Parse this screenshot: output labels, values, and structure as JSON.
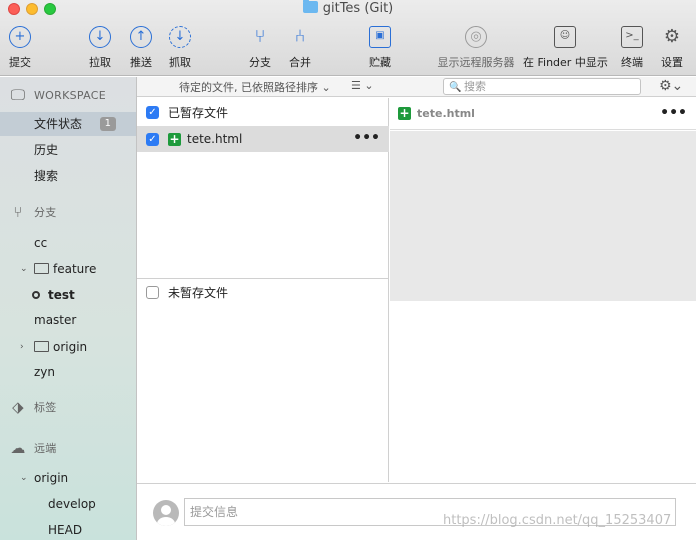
{
  "window": {
    "title": "gitTes (Git)"
  },
  "toolbar": {
    "commit": "提交",
    "pull": "拉取",
    "push": "推送",
    "fetch": "抓取",
    "branch": "分支",
    "merge": "合并",
    "stash": "贮藏",
    "show_remote": "显示远程服务器",
    "show_in_finder": "在 Finder 中显示",
    "terminal": "终端",
    "settings": "设置"
  },
  "filterbar": {
    "sort_label": "待定的文件, 已依照路径排序 ⌄",
    "list_icon": "☰ ⌄",
    "search_placeholder": "搜索"
  },
  "sidebar": {
    "workspace_header": "WORKSPACE",
    "workspace_items": [
      {
        "label": "文件状态",
        "badge": "1"
      },
      {
        "label": "历史"
      },
      {
        "label": "搜索"
      }
    ],
    "branches_header": "分支",
    "branches": [
      "cc",
      "feature",
      "test",
      "master",
      "origin",
      "zyn"
    ],
    "tags_header": "标签",
    "remotes_header": "远端",
    "remotes": [
      "origin",
      "develop",
      "HEAD"
    ]
  },
  "files": {
    "staged_label": "已暂存文件",
    "staged_file": "tete.html",
    "unstaged_label": "未暂存文件"
  },
  "diff": {
    "file_name": "tete.html"
  },
  "commit": {
    "placeholder": "提交信息"
  },
  "watermark": "https://blog.csdn.net/qq_15253407",
  "colors": {
    "accent": "#2a6fd6",
    "added": "#1e9a3c",
    "selection": "#dcdcdc"
  }
}
